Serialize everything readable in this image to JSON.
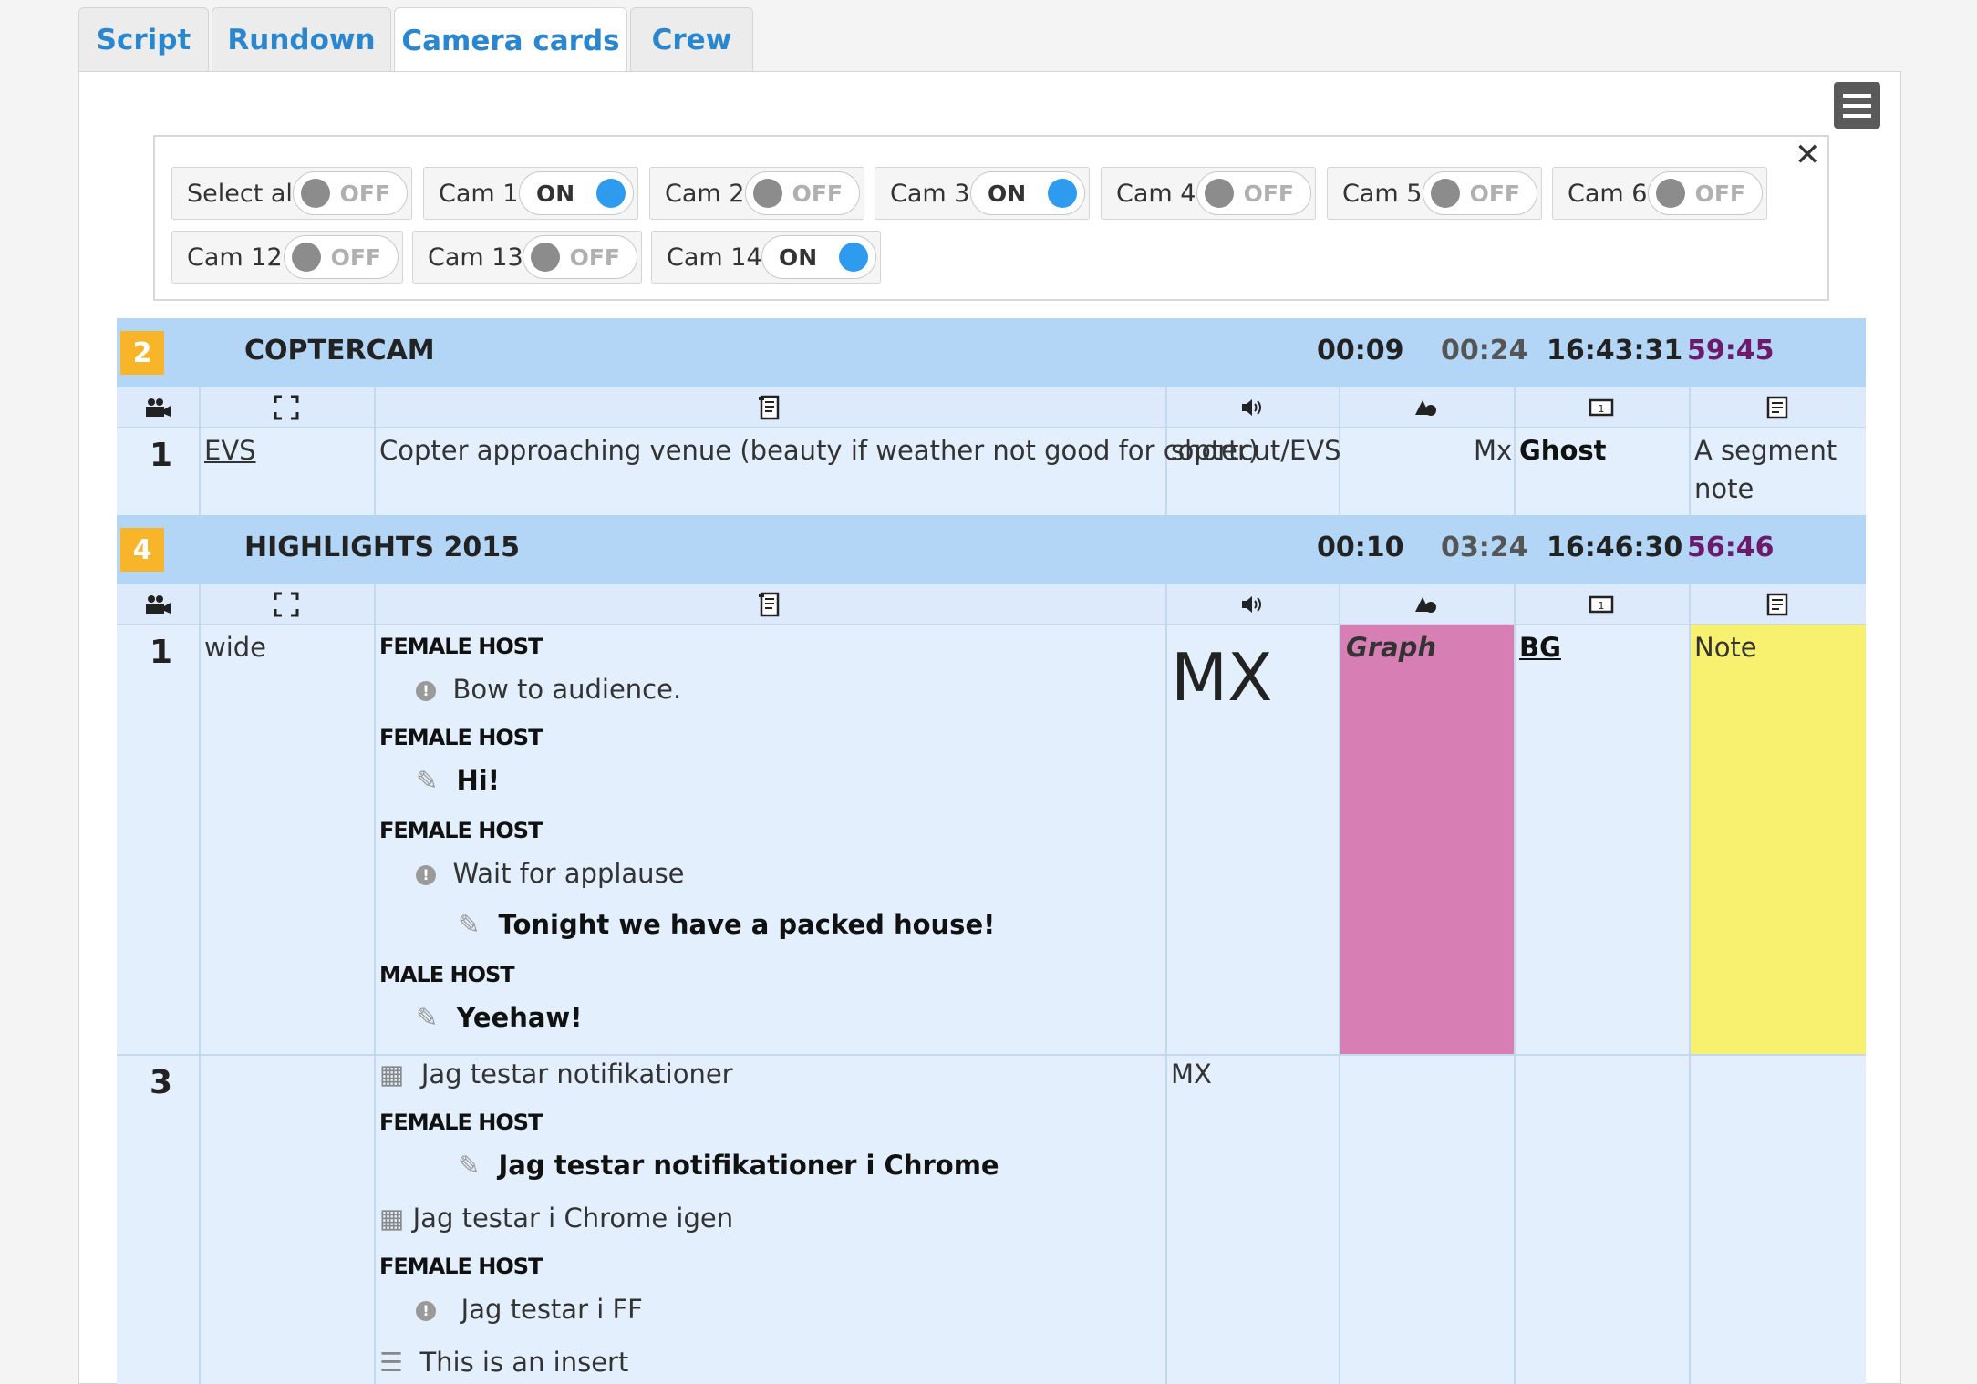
{
  "tabs": [
    "Script",
    "Rundown",
    "Camera cards",
    "Crew"
  ],
  "active_tab": "Camera cards",
  "camera_filter": {
    "buttons": [
      {
        "label": "Select all",
        "state": "OFF"
      },
      {
        "label": "Cam 1",
        "state": "ON"
      },
      {
        "label": "Cam 2",
        "state": "OFF"
      },
      {
        "label": "Cam 3",
        "state": "ON"
      },
      {
        "label": "Cam 4",
        "state": "OFF"
      },
      {
        "label": "Cam 5",
        "state": "OFF"
      },
      {
        "label": "Cam 6",
        "state": "OFF"
      },
      {
        "label": "Cam 12",
        "state": "OFF"
      },
      {
        "label": "Cam 13",
        "state": "OFF"
      },
      {
        "label": "Cam 14",
        "state": "ON"
      }
    ]
  },
  "column_icons": [
    "camera-icon",
    "frame-icon",
    "script-icon",
    "speaker-icon",
    "graphics-icon",
    "screen-icon",
    "note-icon"
  ],
  "segments": [
    {
      "number": "2",
      "title": "COPTERCAM",
      "duration": "00:09",
      "cumulative": "00:24",
      "clock": "16:43:31",
      "remaining": "59:45",
      "rows": [
        {
          "cam": "1",
          "shot": "EVS",
          "script": "Copter approaching venue (beauty if weather not good for copter)",
          "audio": "shortcut/EVS",
          "graphics": "Mx",
          "screen": "Ghost",
          "note_line1": "A segment",
          "note_line2": "note"
        }
      ]
    },
    {
      "number": "4",
      "title": "HIGHLIGHTS 2015",
      "duration": "00:10",
      "cumulative": "03:24",
      "clock": "16:46:30",
      "remaining": "56:46",
      "rows": [
        {
          "cam": "1",
          "shot": "wide",
          "script": [
            {
              "role": "FEMALE HOST"
            },
            {
              "type": "instruction",
              "text": "Bow to audience."
            },
            {
              "role": "FEMALE HOST"
            },
            {
              "type": "speech",
              "text": "Hi!"
            },
            {
              "role": "FEMALE HOST"
            },
            {
              "type": "instruction",
              "text": "Wait for applause"
            },
            {
              "type": "speech",
              "text": "Tonight we have a packed house!"
            },
            {
              "role": "MALE HOST"
            },
            {
              "type": "speech",
              "text": "Yeehaw!"
            }
          ],
          "audio": "MX",
          "graphics": "Graph",
          "screen": "BG",
          "note": "Note",
          "graphics_color": "#d77fb5",
          "note_color": "#f7f16f"
        },
        {
          "cam": "3",
          "shot": "",
          "script": [
            {
              "type": "clip",
              "text": "Jag testar notifikationer"
            },
            {
              "role": "FEMALE HOST"
            },
            {
              "type": "speech",
              "text": "Jag testar notifikationer i Chrome"
            },
            {
              "type": "clip",
              "text": "Jag testar i Chrome igen"
            },
            {
              "role": "FEMALE HOST"
            },
            {
              "type": "instruction",
              "text": "Jag testar i FF"
            },
            {
              "type": "insert",
              "text": "This is an insert"
            }
          ],
          "audio": "MX"
        }
      ]
    }
  ],
  "colors": {
    "tab_text": "#2a87cf",
    "segment_header": "#b3d6f6",
    "segment_badge": "#f8b52a",
    "remaining_time": "#6d1a6c",
    "toggle_on": "#2e9bef",
    "toggle_off": "#8c8c8c"
  }
}
